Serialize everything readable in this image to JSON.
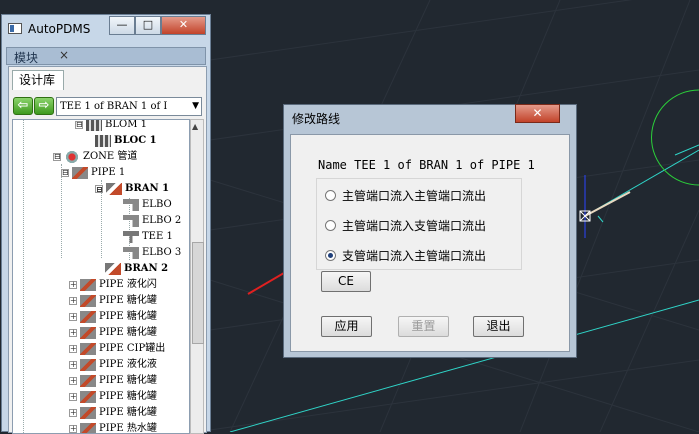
{
  "left_window": {
    "title": "AutoPDMS",
    "buttons": {
      "minimize": "—",
      "maximize": "□",
      "close": "✕"
    },
    "panel_tab": "模块",
    "panel_tab_close": "×",
    "library_tab": "设计库",
    "combo_value": "TEE 1 of BRAN 1 of I",
    "tree": [
      {
        "label": "BLOM 1",
        "expander": "⊟",
        "icon": "bloc-icon",
        "bold": false
      },
      {
        "label": "BLOC 1",
        "expander": "",
        "icon": "bloc-icon",
        "bold": true
      },
      {
        "label": "ZONE 管道",
        "expander": "⊟",
        "icon": "zone-icon",
        "bold": false
      },
      {
        "label": "PIPE 1",
        "expander": "⊟",
        "icon": "pipe-icon",
        "bold": false
      },
      {
        "label": "BRAN 1",
        "expander": "⊟",
        "icon": "bran-icon",
        "bold": true
      },
      {
        "label": "ELBO",
        "expander": "",
        "icon": "elbow-icon",
        "bold": false
      },
      {
        "label": "ELBO 2",
        "expander": "",
        "icon": "elbow-icon",
        "bold": false
      },
      {
        "label": "TEE 1",
        "expander": "",
        "icon": "tee-icon",
        "bold": false
      },
      {
        "label": "ELBO 3",
        "expander": "",
        "icon": "elbow-icon",
        "bold": false
      },
      {
        "label": "BRAN 2",
        "expander": "",
        "icon": "bran-icon",
        "bold": true
      },
      {
        "label": "PIPE 液化闪",
        "expander": "+",
        "icon": "pipe-icon",
        "bold": false
      },
      {
        "label": "PIPE 糖化罐",
        "expander": "+",
        "icon": "pipe-icon",
        "bold": false
      },
      {
        "label": "PIPE 糖化罐",
        "expander": "+",
        "icon": "pipe-icon",
        "bold": false
      },
      {
        "label": "PIPE 糖化罐",
        "expander": "+",
        "icon": "pipe-icon",
        "bold": false
      },
      {
        "label": "PIPE CIP罐出",
        "expander": "+",
        "icon": "pipe-icon",
        "bold": false
      },
      {
        "label": "PIPE 液化液",
        "expander": "+",
        "icon": "pipe-icon",
        "bold": false
      },
      {
        "label": "PIPE 糖化罐",
        "expander": "+",
        "icon": "pipe-icon",
        "bold": false
      },
      {
        "label": "PIPE 糖化罐",
        "expander": "+",
        "icon": "pipe-icon",
        "bold": false
      },
      {
        "label": "PIPE 糖化罐",
        "expander": "+",
        "icon": "pipe-icon",
        "bold": false
      },
      {
        "label": "PIPE 热水罐",
        "expander": "+",
        "icon": "pipe-icon",
        "bold": false
      }
    ]
  },
  "dialog": {
    "title": "修改路线",
    "close": "✕",
    "name_line": "Name  TEE 1 of BRAN 1 of PIPE 1",
    "options": [
      {
        "label": "主管端口流入主管端口流出",
        "checked": false
      },
      {
        "label": "主管端口流入支管端口流出",
        "checked": false
      },
      {
        "label": "支管端口流入主管端口流出",
        "checked": true
      }
    ],
    "ce_button": "CE",
    "apply_button": "应用",
    "reset_button": "重置",
    "exit_button": "退出"
  },
  "colors": {
    "cad_background": "#212830",
    "grid": "#2d343d",
    "pipe_line": "#2fd5c8",
    "circle": "#2bcf3a",
    "arrow": "#e02020",
    "axis_blue": "#2a44ff"
  }
}
